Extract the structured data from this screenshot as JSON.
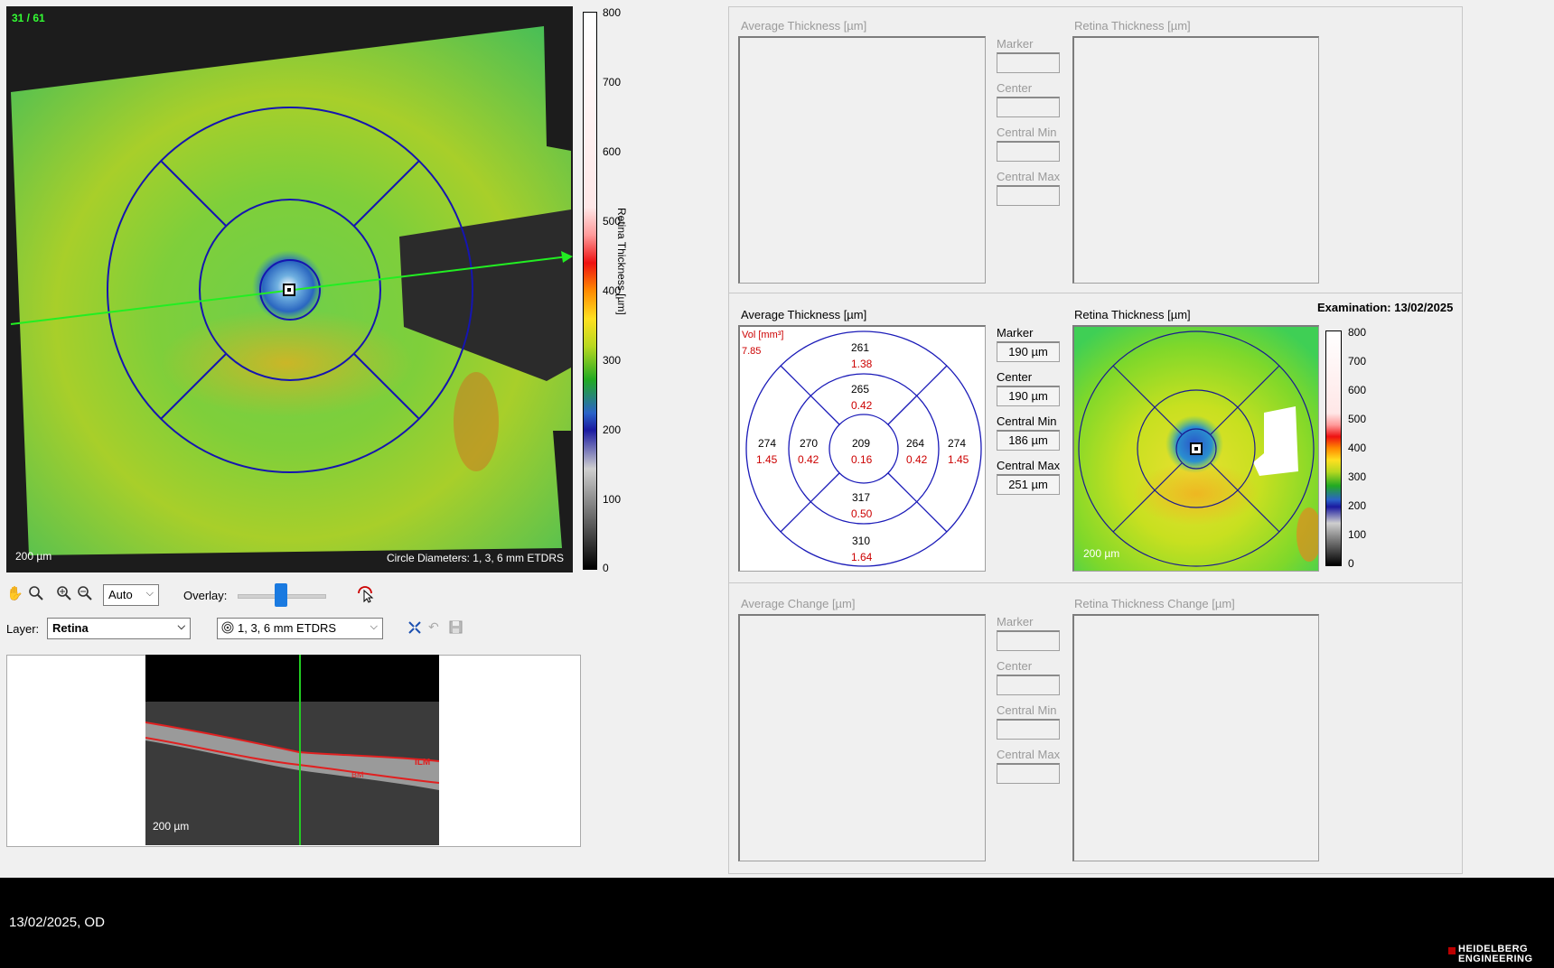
{
  "fundus": {
    "counter": "31 / 61",
    "scale_label": "200 µm",
    "circle_label": "Circle Diameters: 1, 3, 6 mm ETDRS"
  },
  "colorbar": {
    "title": "Retina Thickness [µm]",
    "ticks": [
      "800",
      "700",
      "600",
      "500",
      "400",
      "300",
      "200",
      "100",
      "0"
    ]
  },
  "toolbar": {
    "zoom_select": "Auto",
    "overlay_label": "Overlay:",
    "overlay_level": 0.5,
    "layer_label": "Layer:",
    "layer_select": "Retina",
    "grid_select": "1, 3, 6 mm ETDRS"
  },
  "bscan": {
    "scale_label": "200 µm",
    "ilm_label": "ILM",
    "bm_label": "BM"
  },
  "top_panel": {
    "avg_title": "Average Thickness [µm]",
    "map_title": "Retina Thickness [µm]",
    "marker_label": "Marker",
    "center_label": "Center",
    "cmin_label": "Central Min",
    "cmax_label": "Central Max"
  },
  "mid_panel": {
    "avg_title": "Average Thickness [µm]",
    "map_title": "Retina Thickness [µm]",
    "exam_label": "Examination: 13/02/2025",
    "vol_label": "Vol [mm³]",
    "vol_value": "7.85",
    "marker_label": "Marker",
    "marker_value": "190 µm",
    "center_label": "Center",
    "center_value": "190 µm",
    "cmin_label": "Central Min",
    "cmin_value": "186 µm",
    "cmax_label": "Central Max",
    "cmax_value": "251 µm",
    "map_scale_label": "200 µm",
    "etdrs": {
      "outer_top": {
        "thickness": "261",
        "volume": "1.38"
      },
      "inner_top": {
        "thickness": "265",
        "volume": "0.42"
      },
      "outer_left": {
        "thickness": "274",
        "volume": "1.45"
      },
      "inner_left": {
        "thickness": "270",
        "volume": "0.42"
      },
      "center": {
        "thickness": "209",
        "volume": "0.16"
      },
      "inner_right": {
        "thickness": "264",
        "volume": "0.42"
      },
      "outer_right": {
        "thickness": "274",
        "volume": "1.45"
      },
      "inner_bottom": {
        "thickness": "317",
        "volume": "0.50"
      },
      "outer_bottom": {
        "thickness": "310",
        "volume": "1.64"
      }
    },
    "small_bar_ticks": [
      "800",
      "700",
      "600",
      "500",
      "400",
      "300",
      "200",
      "100",
      "0"
    ]
  },
  "bottom_panel": {
    "avg_title": "Average Change [µm]",
    "map_title": "Retina Thickness Change [µm]",
    "marker_label": "Marker",
    "center_label": "Center",
    "cmin_label": "Central Min",
    "cmax_label": "Central Max"
  },
  "footer": {
    "date_eye": "13/02/2025, OD",
    "logo_line1": "HEIDELBERG",
    "logo_line2": "ENGINEERING"
  }
}
